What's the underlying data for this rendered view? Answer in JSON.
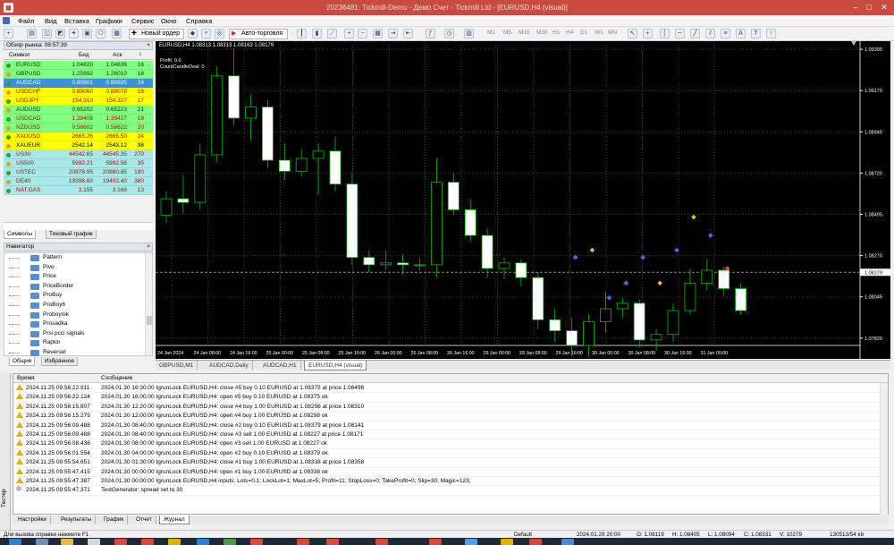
{
  "title": "20236481: Tickmill-Demo - Демо Счет - Tickmill Ltd - [EURUSD,H4 (visual)]",
  "menu": [
    "Файл",
    "Вид",
    "Вставка",
    "Графики",
    "Сервис",
    "Окно",
    "Справка"
  ],
  "toolbar": {
    "new_order": "Новый ордер",
    "autotrading": "Авто-торговля",
    "timeframes": [
      "M1",
      "M5",
      "M15",
      "M30",
      "H1",
      "H4",
      "D1",
      "W1",
      "MN"
    ]
  },
  "market_watch": {
    "title": "Обзор рынка: 08:57:39",
    "columns": [
      "Символ",
      "Бид",
      "Аск",
      "!"
    ],
    "rows": [
      {
        "symbol": "EURUSD",
        "bid": "1.04820",
        "ask": "1.04836",
        "spread": "16",
        "bg": "#80ff80",
        "fg": "#003a00"
      },
      {
        "symbol": "GBPUSD",
        "bid": "1.25992",
        "ask": "1.26010",
        "spread": "18",
        "bg": "#80ff80",
        "fg": "#003a00"
      },
      {
        "symbol": "AUDCAD",
        "bid": "0.90901",
        "ask": "0.90925",
        "spread": "24",
        "bg": "#3d8fe0",
        "fg": "#ffffff"
      },
      {
        "symbol": "USDCHF",
        "bid": "0.89060",
        "ask": "0.89078",
        "spread": "18",
        "bg": "#ffff00",
        "fg": "#c00000"
      },
      {
        "symbol": "USDJPY",
        "bid": "154.310",
        "ask": "154.327",
        "spread": "17",
        "bg": "#ffff00",
        "fg": "#c00000"
      },
      {
        "symbol": "AUDUSD",
        "bid": "0.65202",
        "ask": "0.65223",
        "spread": "21",
        "bg": "#80ff80",
        "fg": "#003a00"
      },
      {
        "symbol": "USDCAD",
        "bid": "1.39408",
        "ask": "1.39427",
        "spread": "19",
        "bg": "#80ff80",
        "fg": "#c00000"
      },
      {
        "symbol": "NZDUSD",
        "bid": "0.58602",
        "ask": "0.58622",
        "spread": "20",
        "bg": "#80ff80",
        "fg": "#c00000"
      },
      {
        "symbol": "XAUUSD",
        "bid": "2665.26",
        "ask": "2665.50",
        "spread": "24",
        "bg": "#ffff00",
        "fg": "#c00000"
      },
      {
        "symbol": "XAUEUR",
        "bid": "2542.14",
        "ask": "2543.12",
        "spread": "98",
        "bg": "#ffff00",
        "fg": "#000000"
      },
      {
        "symbol": "US30",
        "bid": "44542.65",
        "ask": "44545.35",
        "spread": "270",
        "bg": "#a8e8e8",
        "fg": "#c00000"
      },
      {
        "symbol": "US500",
        "bid": "5992.21",
        "ask": "5992.56",
        "spread": "35",
        "bg": "#a8e8e8",
        "fg": "#c00000"
      },
      {
        "symbol": "USTEC",
        "bid": "20878.95",
        "ask": "20880.85",
        "spread": "190",
        "bg": "#a8e8e8",
        "fg": "#c00000"
      },
      {
        "symbol": "DE40",
        "bid": "19398.60",
        "ask": "19402.40",
        "spread": "380",
        "bg": "#a8e8e8",
        "fg": "#c00000"
      },
      {
        "symbol": "NAT.GAS",
        "bid": "3.155",
        "ask": "3.168",
        "spread": "13",
        "bg": "#a8e8e8",
        "fg": "#c00000"
      }
    ],
    "tabs": [
      "Символы",
      "Тиковый график"
    ]
  },
  "navigator": {
    "title": "Навигатор",
    "items": [
      "Pattern",
      "Pivo",
      "Price",
      "PriceBorder",
      "ProBoy",
      "ProBoy6",
      "Proboynik",
      "Prosadka",
      "Prsi pcci signals",
      "Raptor",
      "Reversel"
    ],
    "tabs": [
      "Общие",
      "Избранное"
    ]
  },
  "chart": {
    "header": "EURUSD,H4  1.08313 1.08313 1.08163 1.08179",
    "info_lines": [
      "Profit: 0.0",
      "CountCandleDeal: 0"
    ],
    "price_labels": [
      "1.09395",
      "1.09170",
      "1.08945",
      "1.08720",
      "1.08495",
      "1.08270",
      "1.08045",
      "1.07820"
    ],
    "current_price": "1.08179",
    "time_labels": [
      "24 Jan 2024",
      "24 Jan 08:00",
      "24 Jan 16:00",
      "25 Jan 00:00",
      "25 Jan 08:00",
      "25 Jan 16:00",
      "26 Jan 00:00",
      "26 Jan 08:00",
      "26 Jan 16:00",
      "29 Jan 00:00",
      "29 Jan 08:00",
      "29 Jan 16:00",
      "30 Jan 00:00",
      "30 Jan 08:00",
      "30 Jan 16:00",
      "31 Jan 00:00"
    ],
    "tabs": [
      "GBPUSD,M1",
      "AUDCAD,Daily",
      "AUDCAD,H1",
      "EURUSD,H4 (visual)"
    ],
    "candles": [
      [
        1.0849,
        1.0862,
        1.0845,
        1.0858
      ],
      [
        1.0858,
        1.0871,
        1.085,
        1.0856
      ],
      [
        1.0856,
        1.0888,
        1.0852,
        1.0882
      ],
      [
        1.0882,
        1.093,
        1.0878,
        1.0925
      ],
      [
        1.0925,
        1.094,
        1.0898,
        1.0902
      ],
      [
        1.0902,
        1.0915,
        1.089,
        1.0908
      ],
      [
        1.0908,
        1.0912,
        1.0875,
        1.0879
      ],
      [
        1.0879,
        1.0888,
        1.0868,
        1.0873
      ],
      [
        1.0873,
        1.0885,
        1.087,
        1.088
      ],
      [
        1.088,
        1.0888,
        1.086,
        1.0884
      ],
      [
        1.0884,
        1.0892,
        1.0862,
        1.0866
      ],
      [
        1.0866,
        1.0872,
        1.0822,
        1.0826
      ],
      [
        1.0826,
        1.083,
        1.0818,
        1.0822
      ],
      [
        1.0822,
        1.083,
        1.0819,
        1.0823
      ],
      [
        1.0823,
        1.0828,
        1.0817,
        1.0822
      ],
      [
        1.0822,
        1.0826,
        1.0819,
        1.0822
      ],
      [
        1.0822,
        1.088,
        1.0815,
        1.0867
      ],
      [
        1.0867,
        1.0872,
        1.0849,
        1.0852
      ],
      [
        1.0852,
        1.0858,
        1.0835,
        1.0838
      ],
      [
        1.0838,
        1.0842,
        1.0815,
        1.082
      ],
      [
        1.082,
        1.0826,
        1.0814,
        1.0823
      ],
      [
        1.0823,
        1.0825,
        1.081,
        1.0815
      ],
      [
        1.0815,
        1.0818,
        1.0787,
        1.0792
      ],
      [
        1.0792,
        1.0798,
        1.078,
        1.0786
      ],
      [
        1.0786,
        1.0793,
        1.0772,
        1.0778
      ],
      [
        1.0778,
        1.0795,
        1.0772,
        1.0791
      ],
      [
        1.0791,
        1.0807,
        1.0785,
        1.0798
      ],
      [
        1.0798,
        1.0804,
        1.0793,
        1.0801
      ],
      [
        1.0801,
        1.0803,
        1.0777,
        1.0781
      ],
      [
        1.0781,
        1.0787,
        1.0775,
        1.0784
      ],
      [
        1.0784,
        1.0801,
        1.078,
        1.0797
      ],
      [
        1.0797,
        1.082,
        1.0795,
        1.0812
      ],
      [
        1.0812,
        1.0825,
        1.0808,
        1.0819
      ],
      [
        1.0819,
        1.0821,
        1.0805,
        1.0809
      ],
      [
        1.0809,
        1.0812,
        1.0795,
        1.0797
      ]
    ]
  },
  "journal": {
    "columns": [
      "Время",
      "Сообщение"
    ],
    "rows": [
      {
        "type": "warn",
        "time": "2024.11.25 09:56:22.911",
        "msg": "2024.01.30 16:30:00  IgrunLock EURUSD,H4: close #5 buy 0.10 EURUSD at 1.08375 at price 1.08498"
      },
      {
        "type": "warn",
        "time": "2024.11.25 09:56:22.124",
        "msg": "2024.01.30 16:00:00  IgrunLock EURUSD,H4: open #5 buy 0.10 EURUSD at 1.08375 ok"
      },
      {
        "type": "warn",
        "time": "2024.11.25 09:56:15.807",
        "msg": "2024.01.30 12:20:00  IgrunLock EURUSD,H4: close #4 buy 1.00 EURUSD at 1.08298 at price 1.08310"
      },
      {
        "type": "warn",
        "time": "2024.11.25 09:56:15.279",
        "msg": "2024.01.30 12:00:00  IgrunLock EURUSD,H4: open #4 buy 1.00 EURUSD at 1.08298 ok"
      },
      {
        "type": "warn",
        "time": "2024.11.25 09:56:09.488",
        "msg": "2024.01.30 08:40:00  IgrunLock EURUSD,H4: close #2 buy 0.10 EURUSD at 1.08379 at price 1.08141"
      },
      {
        "type": "warn",
        "time": "2024.11.25 09:56:09.488",
        "msg": "2024.01.30 08:40:00  IgrunLock EURUSD,H4: close #3 sell 1.00 EURUSD at 1.08227 at price 1.08171"
      },
      {
        "type": "warn",
        "time": "2024.11.25 09:56:08.436",
        "msg": "2024.01.30 08:00:00  IgrunLock EURUSD,H4: open #3 sell 1.00 EURUSD at 1.08227 ok"
      },
      {
        "type": "warn",
        "time": "2024.11.25 09:56:01.554",
        "msg": "2024.01.30 04:00:00  IgrunLock EURUSD,H4: open #2 buy 0.10 EURUSD at 1.08379 ok"
      },
      {
        "type": "warn",
        "time": "2024.11.25 09:55:54.651",
        "msg": "2024.01.30 01:30:00  IgrunLock EURUSD,H4: close #1 buy 1.00 EURUSD at 1.08338 at price 1.08358"
      },
      {
        "type": "warn",
        "time": "2024.11.25 09:55:47.415",
        "msg": "2024.01.30 00:00:00  IgrunLock EURUSD,H4: open #1 buy 1.00 EURUSD at 1.08338 ok"
      },
      {
        "type": "warn",
        "time": "2024.11.25 09:55:47.387",
        "msg": "2024.01.30 00:00:00  IgrunLock EURUSD,H4 inputs: Lots=0.1; LockLot=1; MaxLot=5; Profit=11; StopLoss=0; TakeProfit=0; Slip=30; Magic=123;"
      },
      {
        "type": "info",
        "time": "2024.11.25 09:55:47.371",
        "msg": "TestGenerator: spread set to 30"
      }
    ],
    "tabs": [
      "Настройки",
      "Результаты",
      "График",
      "Отчет",
      "Журнал"
    ],
    "side_label": "Тестер"
  },
  "status": {
    "help": "Для вызова справки нажмите F1",
    "profile": "Default",
    "datetime": "2024.01.29 20:00",
    "o": "O: 1.08119",
    "h": "H: 1.08405",
    "l": "L: 1.08094",
    "c": "C: 1.08331",
    "v": "V: 10279",
    "traffic": "130513/54 kb"
  },
  "colors": {
    "bull": "#000000",
    "bear": "#ffffff",
    "wick": "#00c000",
    "grid": "#3a3a3a",
    "axis_text": "#ffffff",
    "title_bar": "#c94a3f"
  }
}
